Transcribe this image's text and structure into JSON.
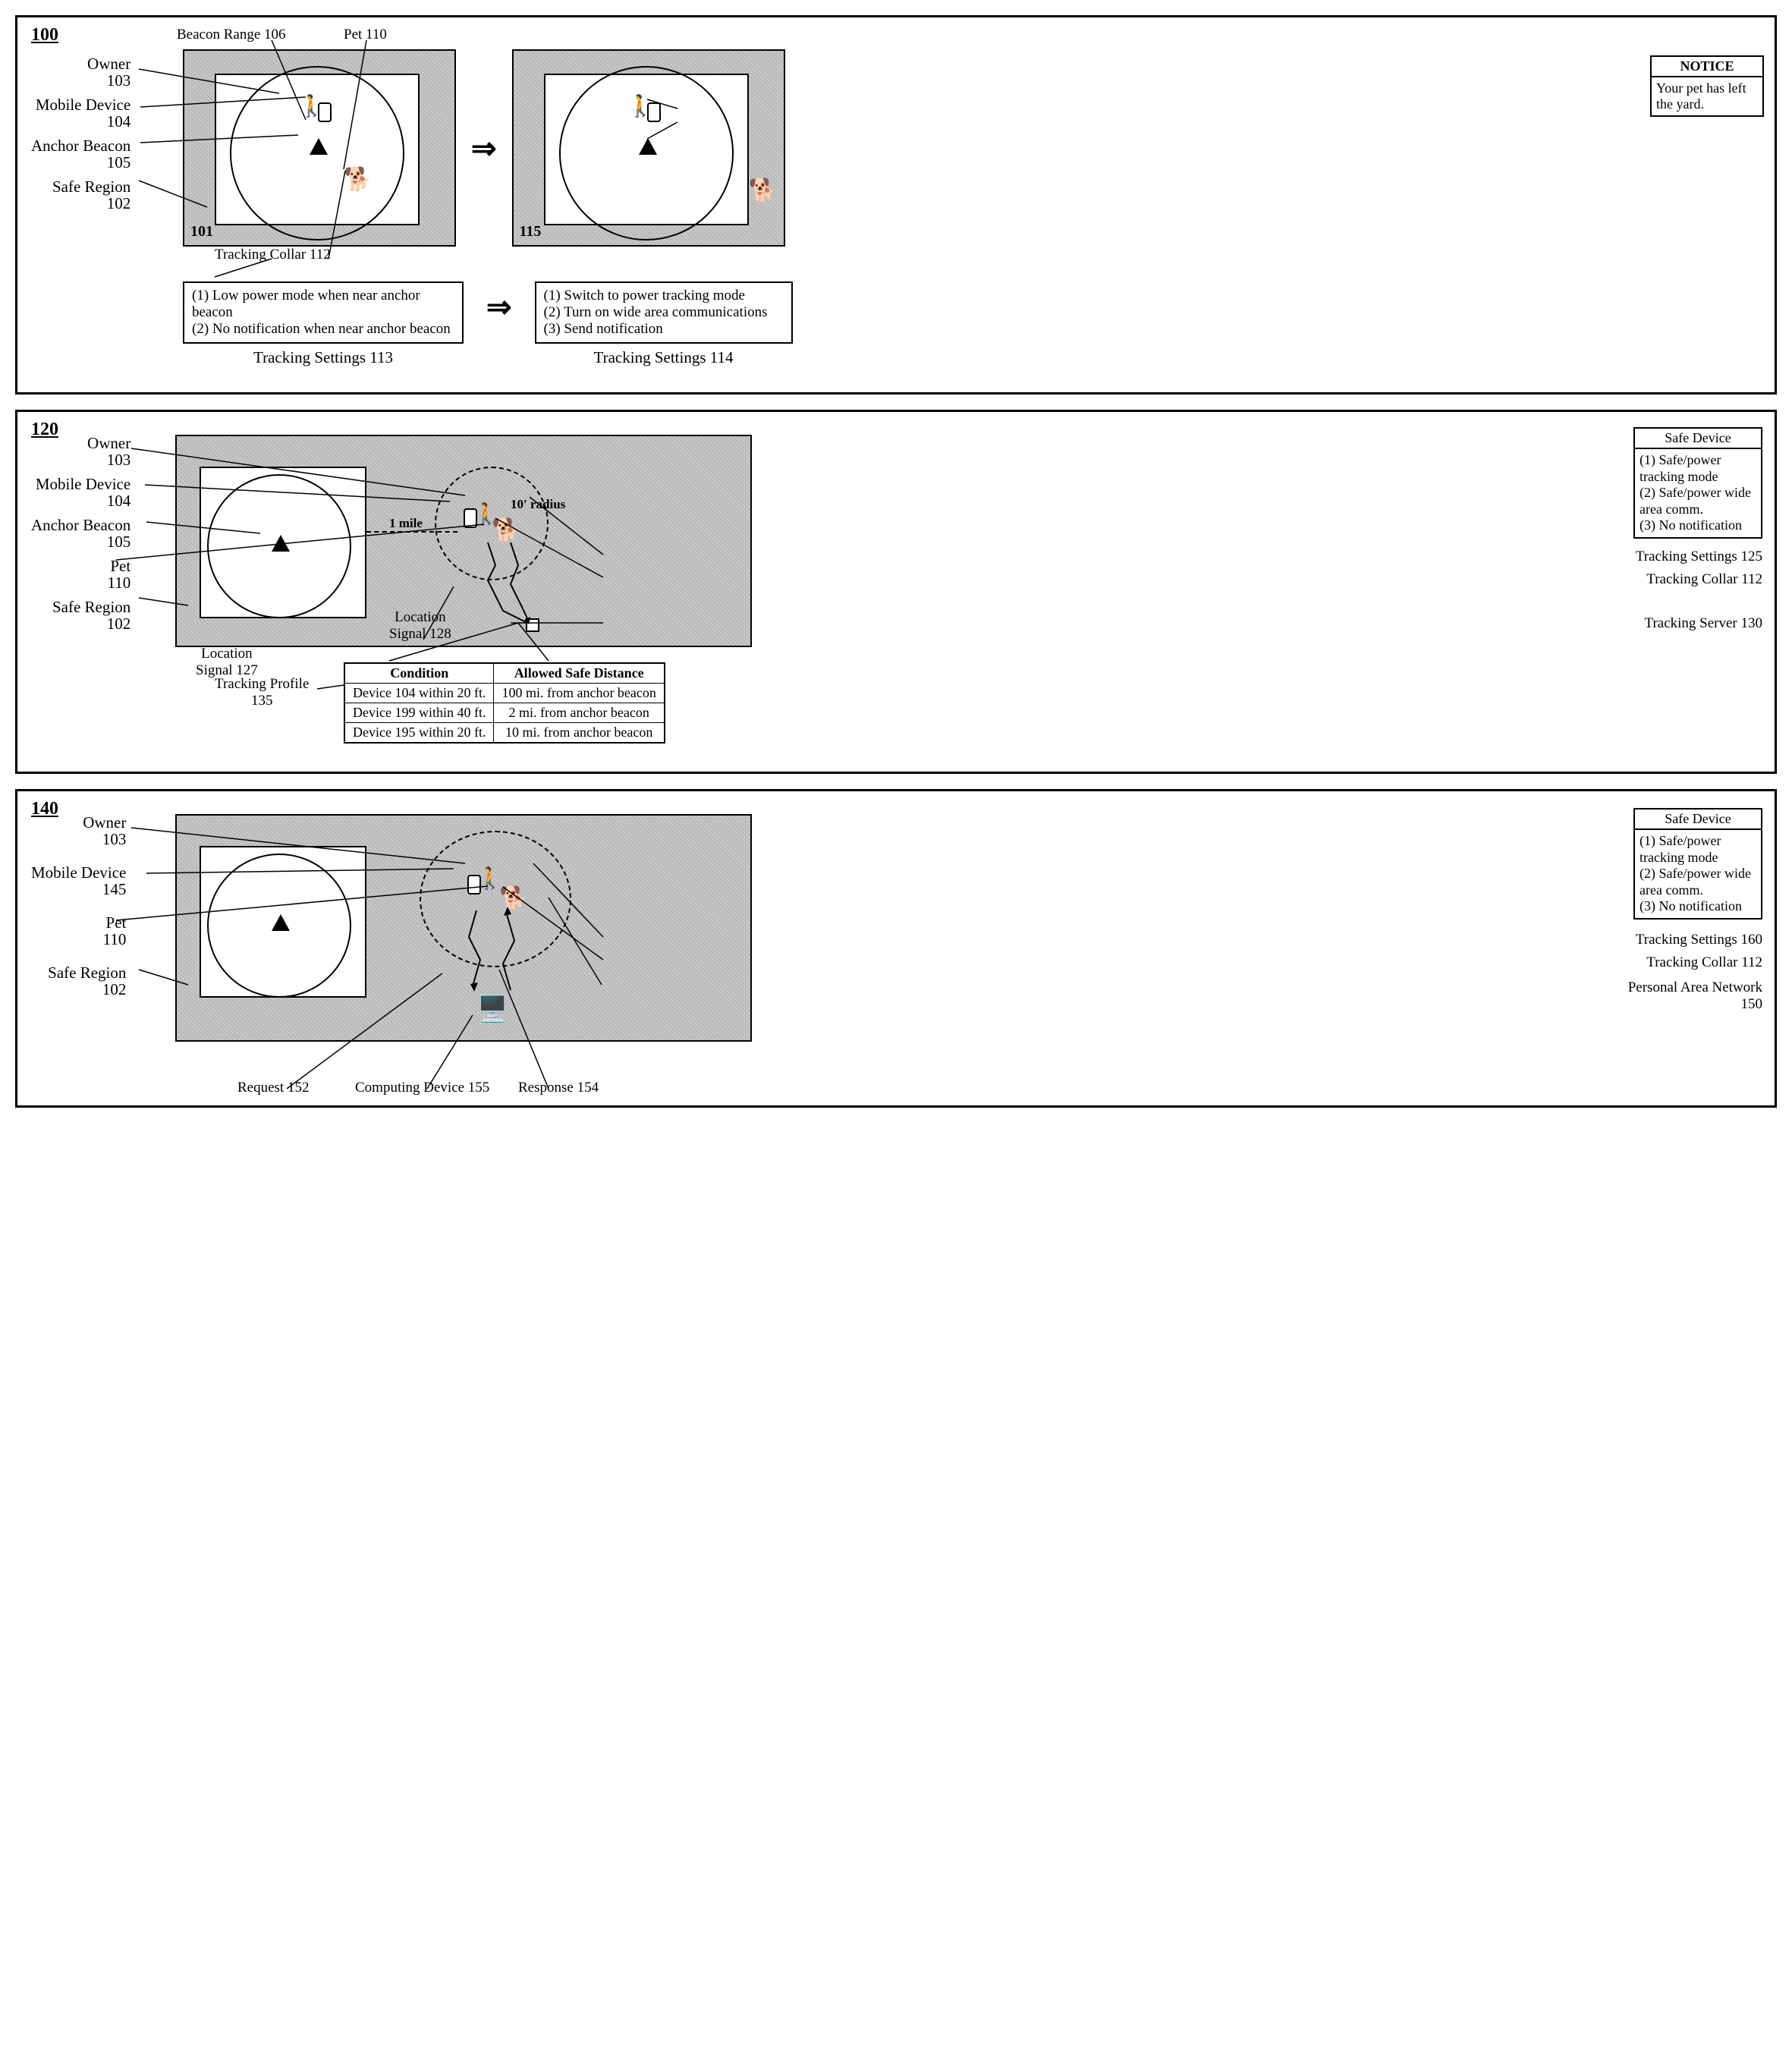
{
  "panel100": {
    "id": "100",
    "labels": [
      {
        "name": "Beacon Range",
        "num": "106"
      },
      {
        "name": "Pet",
        "num": "110"
      },
      {
        "name": "Owner",
        "num": "103"
      },
      {
        "name": "Mobile Device",
        "num": "104"
      },
      {
        "name": "Anchor Beacon",
        "num": "105"
      },
      {
        "name": "Safe Region",
        "num": "102"
      }
    ],
    "scene_left_tag": "101",
    "scene_right_tag": "115",
    "notice": {
      "title": "NOTICE",
      "body": "Your pet has left the yard."
    },
    "collar_label": "Tracking Collar  112",
    "settings_left": {
      "lines": [
        "(1) Low power mode when near anchor beacon",
        "(2) No notification when near anchor beacon"
      ],
      "caption": "Tracking Settings   113"
    },
    "settings_right": {
      "lines": [
        "(1) Switch to power tracking mode",
        "(2) Turn on wide area communications",
        "(3) Send notification"
      ],
      "caption": "Tracking Settings   114"
    }
  },
  "panel120": {
    "id": "120",
    "labels": [
      {
        "name": "Owner",
        "num": "103"
      },
      {
        "name": "Mobile Device",
        "num": "104"
      },
      {
        "name": "Anchor Beacon",
        "num": "105"
      },
      {
        "name": "Pet",
        "num": "110"
      },
      {
        "name": "Safe Region",
        "num": "102"
      }
    ],
    "one_mile": "1 mile",
    "radius": "10' radius",
    "safe_device": {
      "title": "Safe Device",
      "lines": [
        "(1) Safe/power tracking mode",
        "(2) Safe/power wide area comm.",
        "(3) No notification"
      ]
    },
    "right_labels": {
      "ts": "Tracking Settings   125",
      "tc": "Tracking Collar 112",
      "srv": "Tracking Server   130"
    },
    "loc127_a": "Location",
    "loc127_b": "Signal  127",
    "loc128_a": "Location",
    "loc128_b": "Signal  128",
    "tp": "Tracking Profile",
    "tp_num": "135",
    "table": {
      "h1": "Condition",
      "h2": "Allowed Safe Distance",
      "rows": [
        [
          "Device 104 within 20 ft.",
          "100 mi. from anchor beacon"
        ],
        [
          "Device 199 within 40 ft.",
          "2 mi. from anchor beacon"
        ],
        [
          "Device 195 within 20 ft.",
          "10 mi. from anchor beacon"
        ]
      ]
    }
  },
  "panel140": {
    "id": "140",
    "labels": [
      {
        "name": "Owner",
        "num": "103"
      },
      {
        "name": "Mobile Device",
        "num": "145"
      },
      {
        "name": "Pet",
        "num": "110"
      },
      {
        "name": "Safe Region",
        "num": "102"
      }
    ],
    "safe_device": {
      "title": "Safe Device",
      "lines": [
        "(1) Safe/power tracking mode",
        "(2) Safe/power wide area comm.",
        "(3) No notification"
      ]
    },
    "right_labels": {
      "ts": "Tracking Settings   160",
      "tc": "Tracking Collar 112",
      "pan": "Personal Area Network",
      "pan_num": "150"
    },
    "req": "Request   152",
    "resp": "Response   154",
    "comp": "Computing Device 155"
  },
  "arrow": "⇒"
}
